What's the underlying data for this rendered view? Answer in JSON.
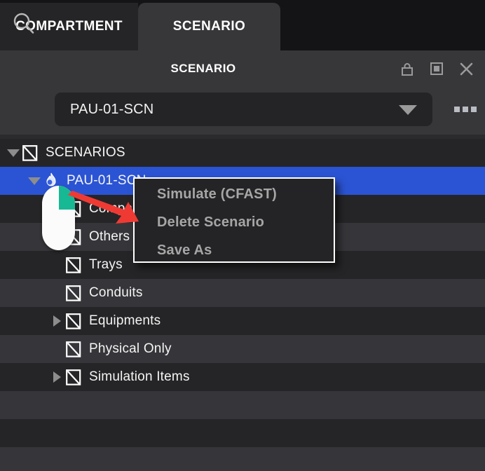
{
  "tabs": [
    {
      "label": "COMPARTMENT",
      "active": false
    },
    {
      "label": "SCENARIO",
      "active": true
    }
  ],
  "panel": {
    "title": "SCENARIO",
    "icons": [
      {
        "name": "lock-icon",
        "label": "lock"
      },
      {
        "name": "maximize-icon",
        "label": "maximize"
      },
      {
        "name": "close-icon",
        "label": "close"
      }
    ]
  },
  "search": {
    "icon": "search-icon",
    "value": "PAU-01-SCN",
    "caret": "chevron-down-icon",
    "overflow": "more-options-icon"
  },
  "tree": {
    "rows": [
      {
        "label": "SCENARIOS",
        "icon": "slashed-square-icon",
        "expander": "down",
        "indent": 0,
        "selected": false,
        "shade": "dark"
      },
      {
        "label": "PAU-01-SCN",
        "icon": "flame-icon",
        "expander": "down",
        "indent": 1,
        "selected": true,
        "shade": "selected"
      },
      {
        "label": "Compartments",
        "icon": "slashed-square-icon",
        "expander": "none",
        "indent": 2,
        "selected": false,
        "shade": "dark"
      },
      {
        "label": "Others",
        "icon": "slashed-square-icon",
        "expander": "none",
        "indent": 2,
        "selected": false,
        "shade": "light"
      },
      {
        "label": "Trays",
        "icon": "slashed-square-icon",
        "expander": "none",
        "indent": 2,
        "selected": false,
        "shade": "dark"
      },
      {
        "label": "Conduits",
        "icon": "slashed-square-icon",
        "expander": "none",
        "indent": 2,
        "selected": false,
        "shade": "light"
      },
      {
        "label": "Equipments",
        "icon": "slashed-square-icon",
        "expander": "right",
        "indent": 2,
        "selected": false,
        "shade": "dark"
      },
      {
        "label": "Physical Only",
        "icon": "slashed-square-icon",
        "expander": "none",
        "indent": 2,
        "selected": false,
        "shade": "light"
      },
      {
        "label": "Simulation Items",
        "icon": "slashed-square-icon",
        "expander": "right",
        "indent": 2,
        "selected": false,
        "shade": "dark"
      }
    ],
    "empty_rows": [
      "light",
      "dark",
      "light"
    ]
  },
  "context_menu": {
    "items": [
      {
        "label": "Simulate (CFAST)"
      },
      {
        "label": "Delete Scenario"
      },
      {
        "label": "Save As"
      }
    ]
  },
  "annotations": {
    "mouse": "mouse-pointer-graphic",
    "arrow": "red-arrow-annotation",
    "arrow_color": "#ef3a34",
    "mouse_accent_color": "#17b894"
  },
  "colors": {
    "selection_blue": "#2b54d4",
    "panel_bg": "#37373a",
    "row_dark": "#252527",
    "row_light": "#36363a",
    "tabbar_bg": "#141416"
  }
}
